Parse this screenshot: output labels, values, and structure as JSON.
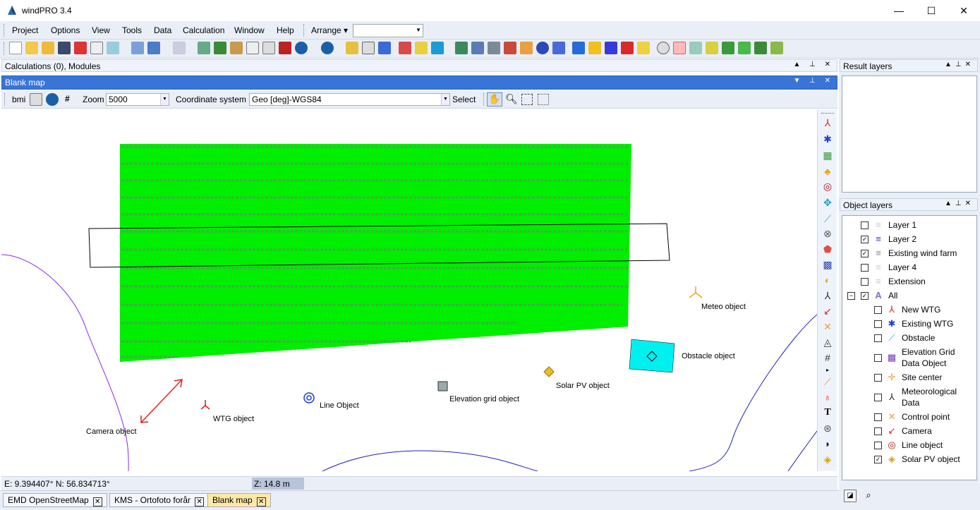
{
  "window": {
    "title": "windPRO 3.4",
    "minimize": "—",
    "maximize": "☐",
    "close": "✕"
  },
  "menubar": {
    "items": [
      "Project",
      "Options",
      "View",
      "Tools",
      "Data",
      "Calculation",
      "Window",
      "Help"
    ],
    "arrange_label": "Arrange ▾"
  },
  "calc_panel": {
    "title": "Calculations (0), Modules"
  },
  "map_panel": {
    "title": "Blank map"
  },
  "map_toolbar": {
    "bmi_label": "bmi",
    "hash_label": "#",
    "zoom_label": "Zoom",
    "zoom_value": "5000",
    "coord_label": "Coordinate system",
    "coord_value": "Geo [deg]-WGS84",
    "select_label": "Select"
  },
  "map": {
    "labels": {
      "meteo": "Meteo object",
      "obstacle": "Obstacle object",
      "solar": "Solar PV object",
      "elevation": "Elevation grid object",
      "line": "Line Object",
      "wtg": "WTG object",
      "camera": "Camera object"
    }
  },
  "status": {
    "coords": "E: 9.394407°   N: 56.834713°",
    "z": "Z: 14.8 m"
  },
  "doc_tabs": [
    {
      "label": "EMD OpenStreetMap",
      "active": false
    },
    {
      "label": "KMS - Ortofoto forår",
      "active": false
    },
    {
      "label": "Blank map",
      "active": true
    }
  ],
  "result_layers": {
    "title": "Result layers"
  },
  "object_layers": {
    "title": "Object layers",
    "layers": [
      {
        "label": "Layer 1",
        "checked": false
      },
      {
        "label": "Layer 2",
        "checked": true
      },
      {
        "label": "Existing wind farm",
        "checked": true
      },
      {
        "label": "Layer 4",
        "checked": false
      },
      {
        "label": "Extension",
        "checked": false
      },
      {
        "label": "All",
        "checked": true
      }
    ],
    "objects": [
      {
        "label": "New WTG",
        "checked": false,
        "color": "#e02020"
      },
      {
        "label": "Existing WTG",
        "checked": false,
        "color": "#1a3fd8"
      },
      {
        "label": "Obstacle",
        "checked": false,
        "color": "#22aadd"
      },
      {
        "label": "Elevation Grid Data Object",
        "checked": false,
        "color": "#7a3fb0"
      },
      {
        "label": "Site center",
        "checked": false,
        "color": "#f0a020"
      },
      {
        "label": "Meteorological Data",
        "checked": false,
        "color": "#333333"
      },
      {
        "label": "Control point",
        "checked": false,
        "color": "#f0a020"
      },
      {
        "label": "Camera",
        "checked": false,
        "color": "#e02020"
      },
      {
        "label": "Line object",
        "checked": false,
        "color": "#a01010"
      },
      {
        "label": "Solar PV object",
        "checked": true,
        "color": "#d4a017"
      }
    ]
  },
  "colors": {
    "field_green": "#00ee00",
    "obstacle_cyan": "#00f0f0",
    "active_header": "#3875d7"
  }
}
